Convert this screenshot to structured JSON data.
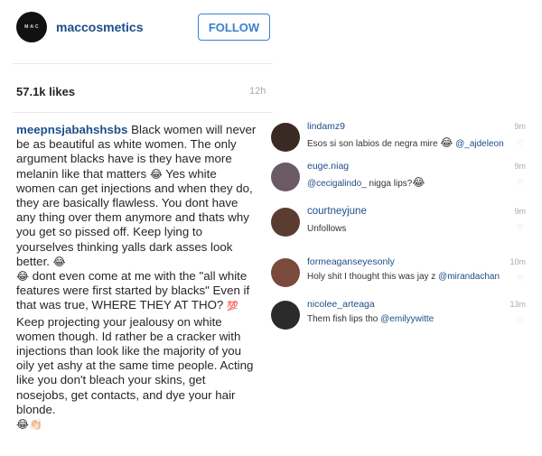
{
  "post": {
    "avatar_text": "M·A·C",
    "username": "maccosmetics",
    "follow_label": "FOLLOW",
    "likes": "57.1k likes",
    "time": "12h"
  },
  "caption": {
    "username": "meepnsjabahshsbs",
    "part1": " Black women will never be as beautiful as white women. The only argument blacks have is they have more melanin like that matters ",
    "emoji1": "😂",
    "part2": " Yes white women can get injections and when they do, they are basically flawless. You dont have any thing over them anymore and thats why you get so pissed off. Keep lying to yourselves thinking yalls dark asses look better. ",
    "emoji2": "😂",
    "emoji3": "😂",
    "part3": " dont even come at me with the \"all white features were first started by blacks\" Even if that was true, WHERE THEY AT THO? ",
    "hundred": "💯",
    "part4": " Keep projecting your jealousy on white women though. Id rather be a cracker with injections than look like the majority of you oily yet ashy at the same time people. Acting like you don't bleach your skins, get nosejobs, get contacts, and dye your hair blonde. ",
    "emoji_end": "😂👏🏻"
  },
  "comments": [
    {
      "username": "lindamz9",
      "text": "Esos si son labios de negra mire",
      "emoji": "😂",
      "mention": "@_ajdeleon",
      "time": "9m",
      "avatar_color": "#3a2a24"
    },
    {
      "username": "euge.niag",
      "text": "",
      "mention": "@cecigalindo",
      "after": "_ nigga lips?",
      "emoji": "😂",
      "time": "9m",
      "avatar_color": "#6b5a63"
    },
    {
      "username": "courtneyjune",
      "text": "Unfollows",
      "time": "9m",
      "avatar_color": "#5a3d30"
    },
    {
      "username": "formeaganseyesonly",
      "text": "Holy shit I thought this was jay z",
      "mention": "@mirandachan",
      "time": "10m",
      "avatar_color": "#7a4a3c"
    },
    {
      "username": "nicolee_arteaga",
      "text": "Them fish lips tho",
      "mention": "@emilyywitte",
      "time": "13m",
      "avatar_color": "#2b2b2b"
    }
  ],
  "icons": {
    "heart": "♡"
  }
}
